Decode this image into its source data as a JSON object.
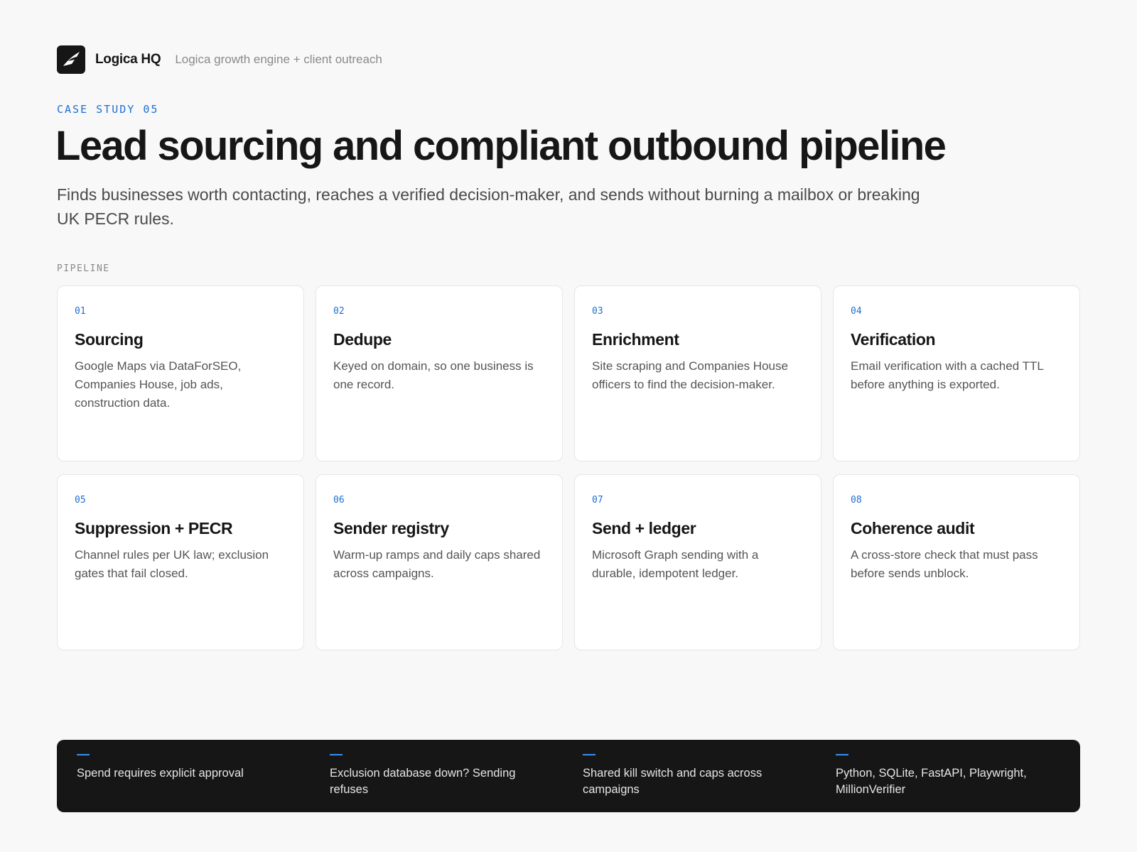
{
  "header": {
    "logo_icon": "lightning-slash-icon",
    "brand": "Logica HQ",
    "subtitle": "Logica growth engine + client outreach"
  },
  "eyebrow": "CASE STUDY 05",
  "title": "Lead sourcing and compliant outbound pipeline",
  "lede": "Finds businesses worth contacting, reaches a verified decision-maker, and sends without burning a mailbox or breaking UK PECR rules.",
  "section_label": "PIPELINE",
  "steps": [
    {
      "num": "01",
      "title": "Sourcing",
      "body": "Google Maps via DataForSEO, Companies House, job ads, construction data."
    },
    {
      "num": "02",
      "title": "Dedupe",
      "body": "Keyed on domain, so one business is one record."
    },
    {
      "num": "03",
      "title": "Enrichment",
      "body": "Site scraping and Companies House officers to find the decision-maker."
    },
    {
      "num": "04",
      "title": "Verification",
      "body": "Email verification with a cached TTL before anything is exported."
    },
    {
      "num": "05",
      "title": "Suppression + PECR",
      "body": "Channel rules per UK law; exclusion gates that fail closed."
    },
    {
      "num": "06",
      "title": "Sender registry",
      "body": "Warm-up ramps and daily caps shared across campaigns."
    },
    {
      "num": "07",
      "title": "Send + ledger",
      "body": "Microsoft Graph sending with a durable, idempotent ledger."
    },
    {
      "num": "08",
      "title": "Coherence audit",
      "body": "A cross-store check that must pass before sends unblock."
    }
  ],
  "footer": [
    "Spend requires explicit approval",
    "Exclusion database down? Sending refuses",
    "Shared kill switch and caps across campaigns",
    "Python, SQLite, FastAPI, Playwright, MillionVerifier"
  ],
  "colors": {
    "accent": "#1f6fd0",
    "footer_bg": "#161616",
    "page_bg": "#f8f8f8"
  }
}
